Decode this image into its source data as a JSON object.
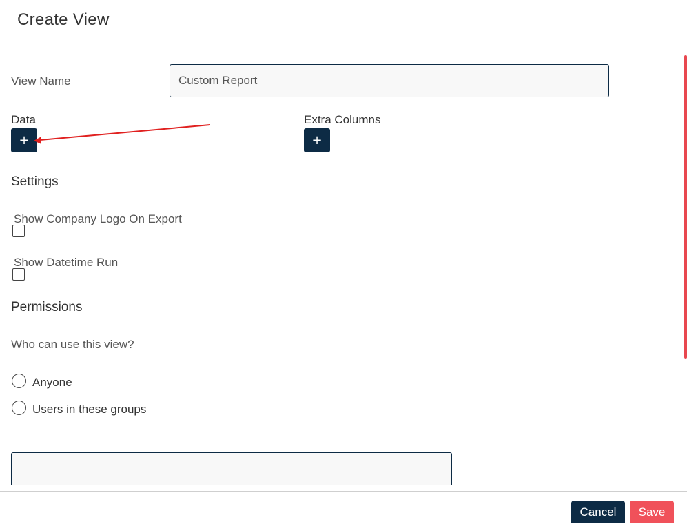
{
  "dialog": {
    "title": "Create View"
  },
  "view_name": {
    "label": "View Name",
    "value": "Custom Report"
  },
  "data_section": {
    "label": "Data",
    "add_label": "+"
  },
  "extra_columns": {
    "label": "Extra Columns",
    "add_label": "+"
  },
  "settings": {
    "heading": "Settings",
    "options": [
      {
        "label": "Show Company Logo On Export",
        "checked": false
      },
      {
        "label": "Show Datetime Run",
        "checked": false
      }
    ]
  },
  "permissions": {
    "heading": "Permissions",
    "question": "Who can use this view?",
    "choices": [
      {
        "label": "Anyone",
        "selected": false
      },
      {
        "label": "Users in these groups",
        "selected": false
      }
    ]
  },
  "footer": {
    "cancel_label": "Cancel",
    "save_label": "Save"
  },
  "colors": {
    "primary": "#0d2b45",
    "danger": "#f0515a",
    "annotation_arrow": "#e0201f"
  }
}
